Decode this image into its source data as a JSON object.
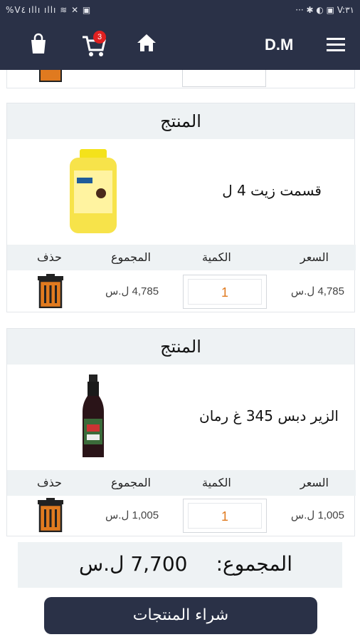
{
  "status_bar": {
    "left_text": "%V٤ ıllı ıllı ≋ ✕ ▣",
    "right_text": "··· ✱ ◐ ▣ V:٣١"
  },
  "app_bar": {
    "brand": "D.M",
    "cart_count": "3",
    "icons": [
      "menu-icon",
      "home-icon",
      "cart-icon",
      "bag-icon"
    ]
  },
  "cards": [
    {
      "header": "المنتج",
      "name": "قسمت زيت 4 ل",
      "columns": {
        "price": "السعر",
        "qty": "الكمية",
        "total": "المجموع",
        "delete": "حذف"
      },
      "price": "4,785 ل.س",
      "qty": "1",
      "total": "4,785 ل.س"
    },
    {
      "header": "المنتج",
      "name": "الزير دبس 345 غ رمان",
      "columns": {
        "price": "السعر",
        "qty": "الكمية",
        "total": "المجموع",
        "delete": "حذف"
      },
      "price": "1,005 ل.س",
      "qty": "1",
      "total": "1,005 ل.س"
    }
  ],
  "summary": {
    "label": "المجموع:",
    "amount": "7,700 ل.س"
  },
  "buy_button": "شراء المنتجات",
  "colors": {
    "primary": "#2a3147",
    "accent": "#e07a1f",
    "badge": "#e02020",
    "header_bg": "#eef2f4"
  }
}
